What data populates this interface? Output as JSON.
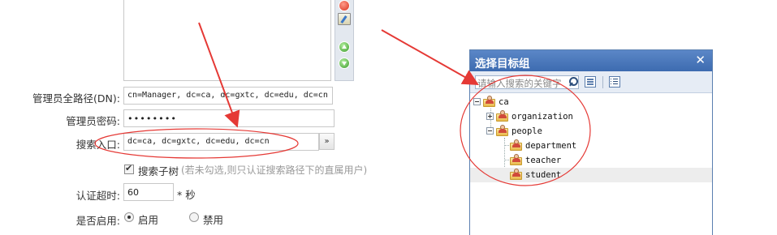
{
  "form": {
    "admin_dn_label": "管理员全路径(DN):",
    "admin_dn_value": "cn=Manager, dc=ca, dc=gxtc, dc=edu, dc=cn",
    "admin_pwd_label": "管理员密码:",
    "admin_pwd_value": "••••••••",
    "search_entry_label": "搜索入口:",
    "search_entry_value": "dc=ca, dc=gxtc, dc=edu, dc=cn",
    "browse_button": "»",
    "search_subtree_label": "搜索子树",
    "search_subtree_hint": "(若未勾选,则只认证搜索路径下的直属用户)",
    "timeout_label": "认证超时:",
    "timeout_value": "60",
    "timeout_unit": "* 秒",
    "enabled_label": "是否启用:",
    "enabled_on": "启用",
    "enabled_off": "禁用"
  },
  "dialog": {
    "title": "选择目标组",
    "close": "✕",
    "search_placeholder": "请输入搜索的关键字",
    "tree": [
      {
        "label": "ca"
      },
      {
        "label": "organization"
      },
      {
        "label": "people"
      },
      {
        "label": "department"
      },
      {
        "label": "teacher"
      },
      {
        "label": "student"
      }
    ]
  },
  "colors": {
    "title_bar": "#4a78bc",
    "annotation_red": "#e53935"
  },
  "icons": [
    "remove-icon",
    "edit-icon",
    "move-up-icon",
    "move-down-icon",
    "search-icon",
    "expand-all-icon",
    "list-icon",
    "folder-user-icon"
  ]
}
